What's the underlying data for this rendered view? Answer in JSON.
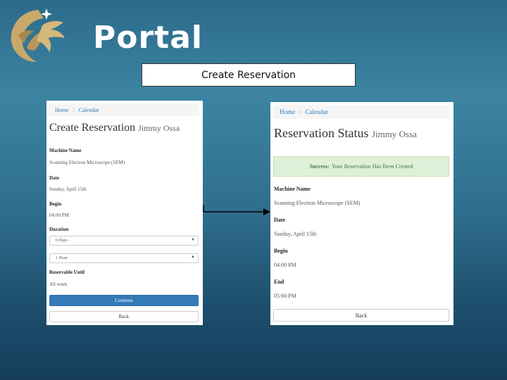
{
  "slide": {
    "title": "Portal",
    "caption": "Create Reservation"
  },
  "colors": {
    "accent_gold": "#c9a96a",
    "link": "#337ab7",
    "primary_button": "#337ab7",
    "success_bg": "#dff0d8",
    "success_text": "#3c763d"
  },
  "left_screen": {
    "breadcrumb": [
      "Home",
      "Calendar"
    ],
    "title": "Create Reservation",
    "user": "Jimmy Ossa",
    "machine_label": "Machine Name",
    "machine_value": "Scanning Electron Microscope (SEM)",
    "date_label": "Date",
    "date_value": "Sunday, April 15th",
    "begin_label": "Begin",
    "begin_value": "04:00 PM",
    "duration_label": "Duration",
    "duration_days": "0 Days",
    "duration_hours": "1 Hour",
    "reservable_label": "Reservable Until",
    "reservable_value": "All week",
    "continue_label": "Continue",
    "back_label": "Back"
  },
  "right_screen": {
    "breadcrumb": [
      "Home",
      "Calendar"
    ],
    "title": "Reservation Status",
    "user": "Jimmy Ossa",
    "alert_strong": "Success:",
    "alert_text": "Your Reservation Has Been Created",
    "machine_label": "Machine Name",
    "machine_value": "Scanning Electron Microscope (SEM)",
    "date_label": "Date",
    "date_value": "Sunday, April 15th",
    "begin_label": "Begin",
    "begin_value": "04:00 PM",
    "end_label": "End",
    "end_value": "05:00 PM",
    "back_label": "Back"
  }
}
